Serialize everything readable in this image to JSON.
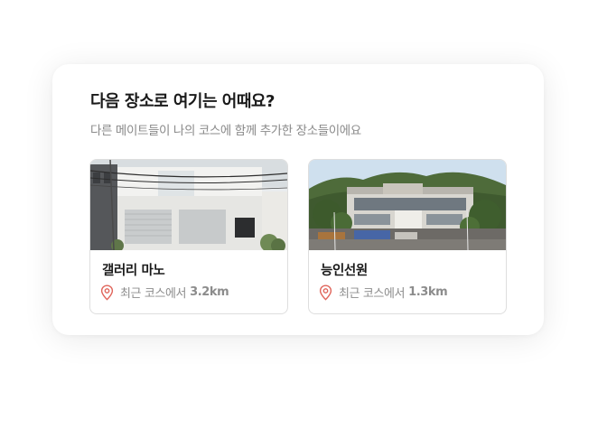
{
  "section": {
    "title": "다음 장소로 여기는 어때요?",
    "subtitle": "다른 메이트들이 나의 코스에 함께 추가한 장소들이에요"
  },
  "places": [
    {
      "name": "갤러리 마노",
      "distance_prefix": "최근 코스에서",
      "distance_value": "3.2km",
      "icon": "location-pin-icon",
      "image": "gallery-building-photo"
    },
    {
      "name": "능인선원",
      "distance_prefix": "최근 코스에서",
      "distance_value": "1.3km",
      "icon": "location-pin-icon",
      "image": "temple-building-mountain-photo"
    }
  ],
  "colors": {
    "pin": "#e0655b",
    "title": "#1a1a1a",
    "muted": "#8a8a8a",
    "border": "#dedede"
  }
}
